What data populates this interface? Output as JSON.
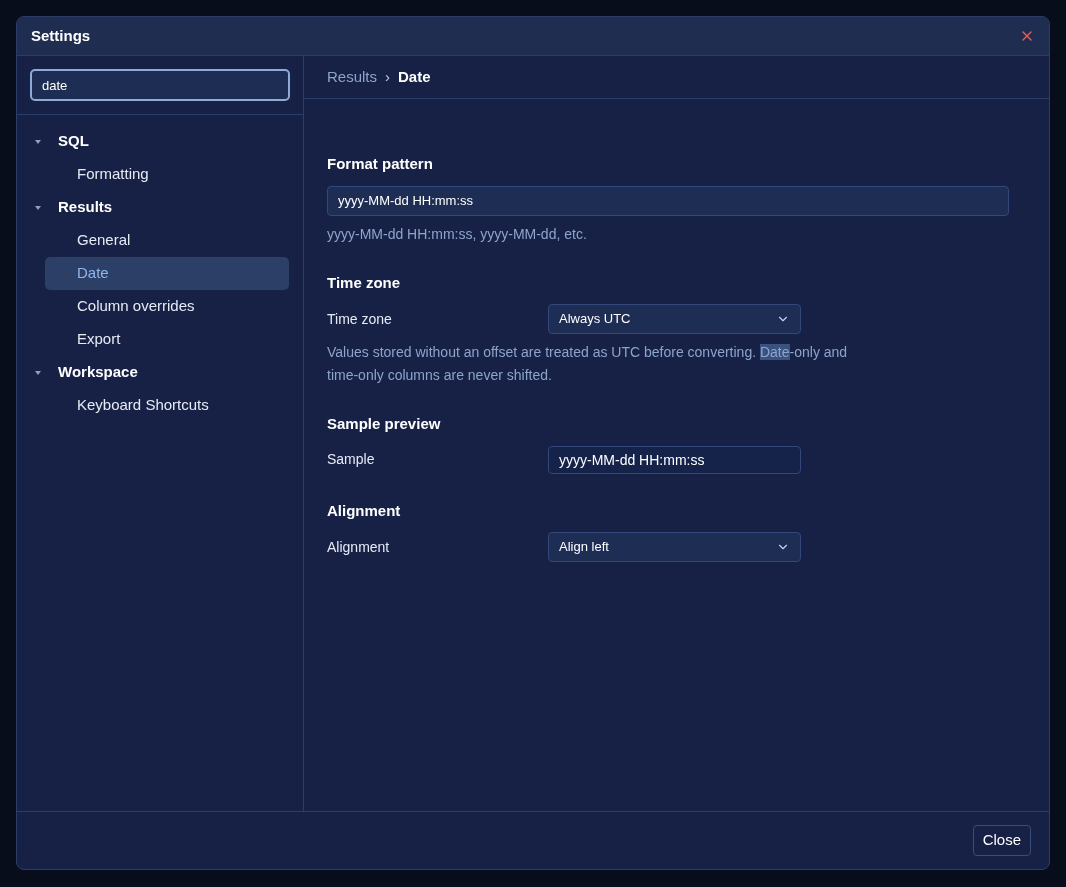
{
  "dialog": {
    "title": "Settings"
  },
  "search": {
    "value": "date"
  },
  "tree": [
    {
      "label": "SQL",
      "expanded": true,
      "selected": false,
      "children": [
        {
          "label": "Formatting",
          "selected": false
        }
      ]
    },
    {
      "label": "Results",
      "expanded": true,
      "selected": false,
      "children": [
        {
          "label": "General",
          "selected": false
        },
        {
          "label": "Date",
          "selected": true
        },
        {
          "label": "Column overrides",
          "selected": false
        },
        {
          "label": "Export",
          "selected": false
        }
      ]
    },
    {
      "label": "Workspace",
      "expanded": true,
      "selected": false,
      "children": [
        {
          "label": "Keyboard Shortcuts",
          "selected": false
        }
      ]
    }
  ],
  "breadcrumb": {
    "parent": "Results",
    "separator": "›",
    "current": "Date"
  },
  "sections": [
    {
      "title": "Format pattern",
      "fields": [
        {
          "kind": "wide_text",
          "value": "yyyy-MM-dd HH:mm:ss"
        }
      ],
      "help": {
        "before": "yyyy-MM-dd HH:mm:ss, yyyy-MM-dd, etc."
      }
    },
    {
      "title": "Time zone",
      "fields": [
        {
          "kind": "select",
          "label": "Time zone",
          "value": "Always UTC"
        }
      ],
      "help": {
        "before": "Values stored without an offset are treated as UTC before converting. ",
        "match": "Date",
        "after": "-only and time-only columns are never shifted."
      }
    },
    {
      "title": "Sample preview",
      "fields": [
        {
          "kind": "text",
          "label": "Sample",
          "value": "yyyy-MM-dd HH:mm:ss"
        }
      ]
    },
    {
      "title": "Alignment",
      "fields": [
        {
          "kind": "select",
          "label": "Alignment",
          "value": "Align left"
        }
      ]
    }
  ],
  "footer": {
    "close_button": "Close"
  }
}
